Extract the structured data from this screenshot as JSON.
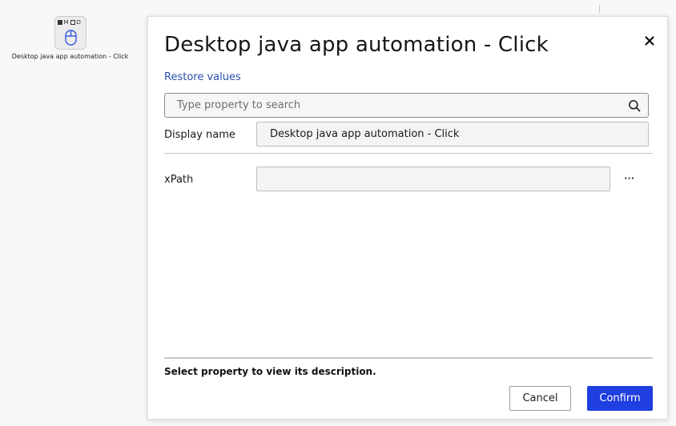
{
  "canvas": {
    "node": {
      "flag_m": "M",
      "flag_d": "D",
      "label": "Desktop java app automation - Click"
    }
  },
  "dialog": {
    "title": "Desktop java app automation - Click",
    "restore_label": "Restore values",
    "search": {
      "placeholder": "Type property to search",
      "value": ""
    },
    "properties": [
      {
        "label": "Display name",
        "value": "Desktop java app automation - Click"
      },
      {
        "label": "xPath",
        "value": ""
      }
    ],
    "more_label": "···",
    "description": "Select property to view its description.",
    "buttons": {
      "cancel": "Cancel",
      "confirm": "Confirm"
    }
  },
  "colors": {
    "accent": "#1f3fe0",
    "link": "#2a4fb0"
  },
  "icons": {
    "close": "close-icon",
    "search": "search-icon",
    "node": "mouse-icon"
  }
}
